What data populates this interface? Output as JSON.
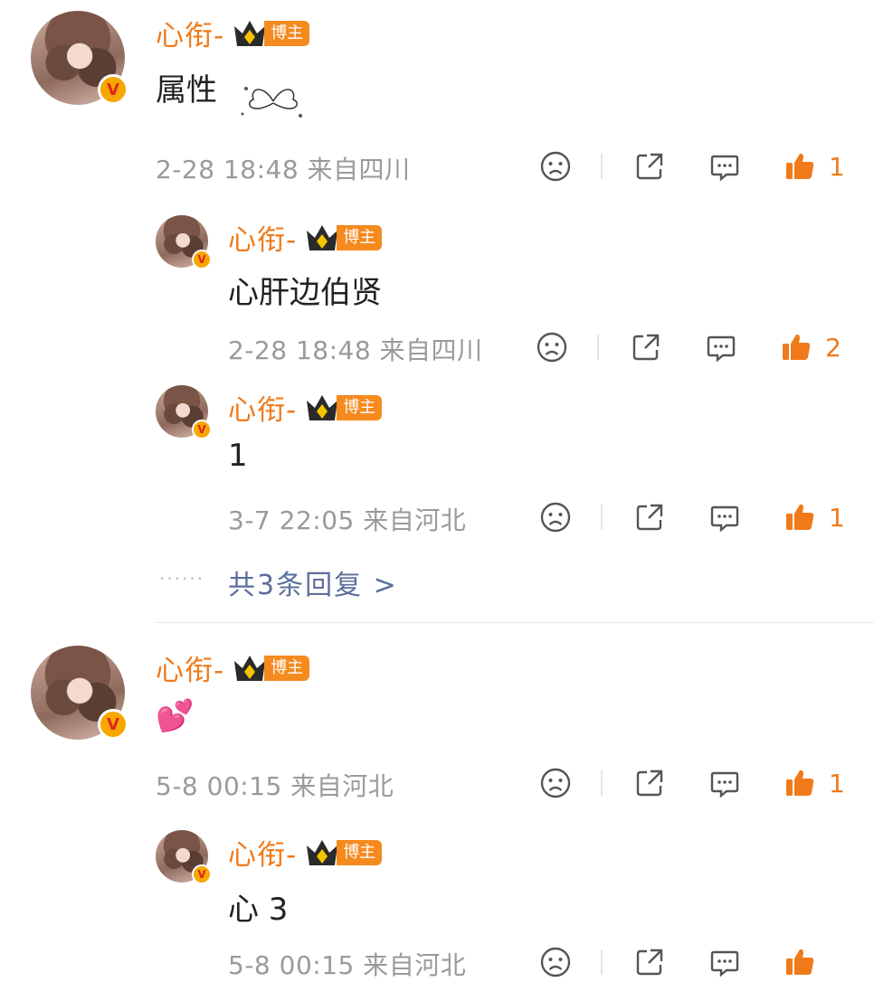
{
  "comments": [
    {
      "name": "心衔-",
      "tag": "博主",
      "text": "属性",
      "meta": "2-28 18:48 来自四川",
      "likes": "1",
      "replies": [
        {
          "name": "心衔-",
          "tag": "博主",
          "text": "心肝边伯贤",
          "meta": "2-28 18:48 来自四川",
          "likes": "2"
        },
        {
          "name": "心衔-",
          "tag": "博主",
          "text": "1",
          "meta": "3-7 22:05 来自河北",
          "likes": "1"
        }
      ],
      "more_replies": "共3条回复 >"
    },
    {
      "name": "心衔-",
      "tag": "博主",
      "text": "💕",
      "meta": "5-8 00:15 来自河北",
      "likes": "1",
      "replies": [
        {
          "name": "心衔-",
          "tag": "博主",
          "text": "心 3",
          "meta": "5-8 00:15 来自河北",
          "likes": ""
        }
      ]
    }
  ],
  "colors": {
    "accent": "#f07a1a",
    "link": "#5b6e9c",
    "meta": "#9a9a9a"
  },
  "icons": [
    "sad-face-icon",
    "share-icon",
    "comment-icon",
    "thumbs-up-icon",
    "crown-icon",
    "verified-v-icon",
    "butterfly-sticker-icon"
  ]
}
